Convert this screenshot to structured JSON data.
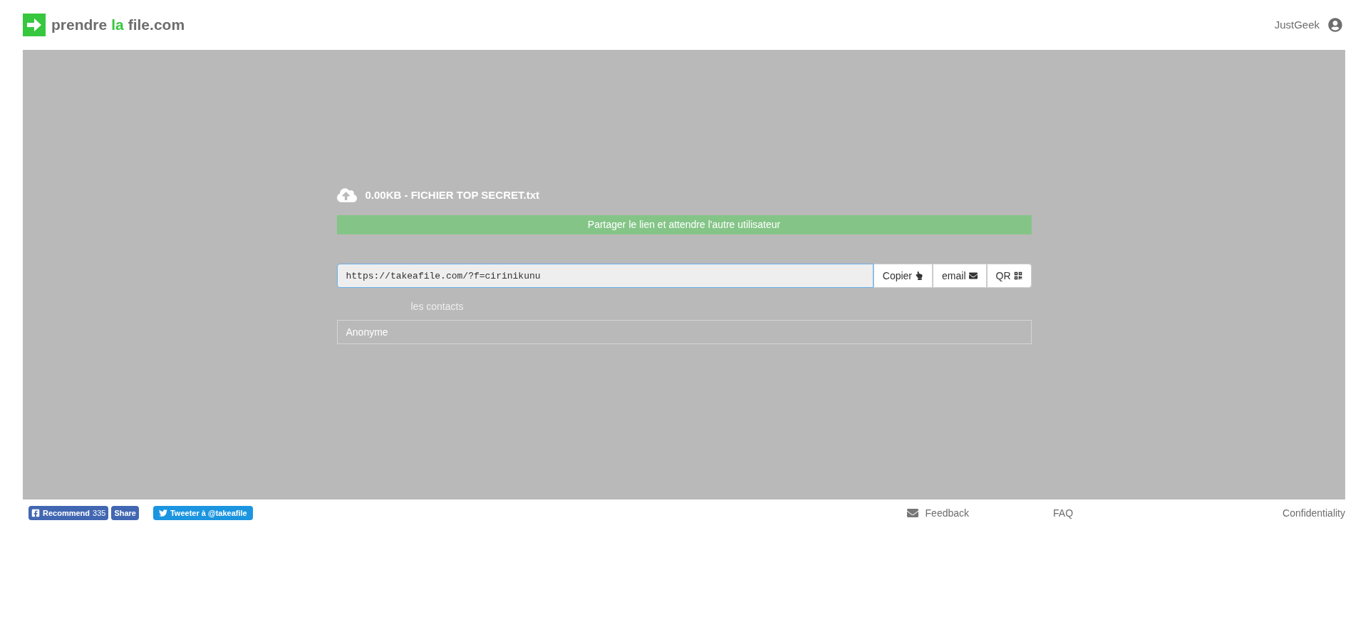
{
  "header": {
    "logo": [
      {
        "text": "prendre",
        "accent": false
      },
      {
        "text": "la",
        "accent": true
      },
      {
        "text": "file.com",
        "accent": false
      }
    ],
    "user": "JustGeek"
  },
  "upload": {
    "file_line": "0.00KB - FICHIER TOP SECRET.txt",
    "status": "Partager le lien et attendre l'autre utilisateur",
    "link": {
      "value": "https://takeafile.com/?f=cirinikunu"
    },
    "actions": [
      {
        "kind": "copy",
        "label": "Copier"
      },
      {
        "kind": "email",
        "label": "email"
      },
      {
        "kind": "qr",
        "label": "QR"
      }
    ],
    "contacts_label": "les contacts",
    "contacts": [
      "Anonyme"
    ]
  },
  "footer": {
    "facebook": {
      "label": "Recommend",
      "count": "335",
      "share": "Share"
    },
    "twitter": "Tweeter à @takeafile",
    "links": [
      {
        "kind": "feedback",
        "label": "Feedback"
      },
      {
        "kind": "plain",
        "label": "FAQ"
      },
      {
        "kind": "plain",
        "label": "Confidentiality"
      }
    ]
  }
}
